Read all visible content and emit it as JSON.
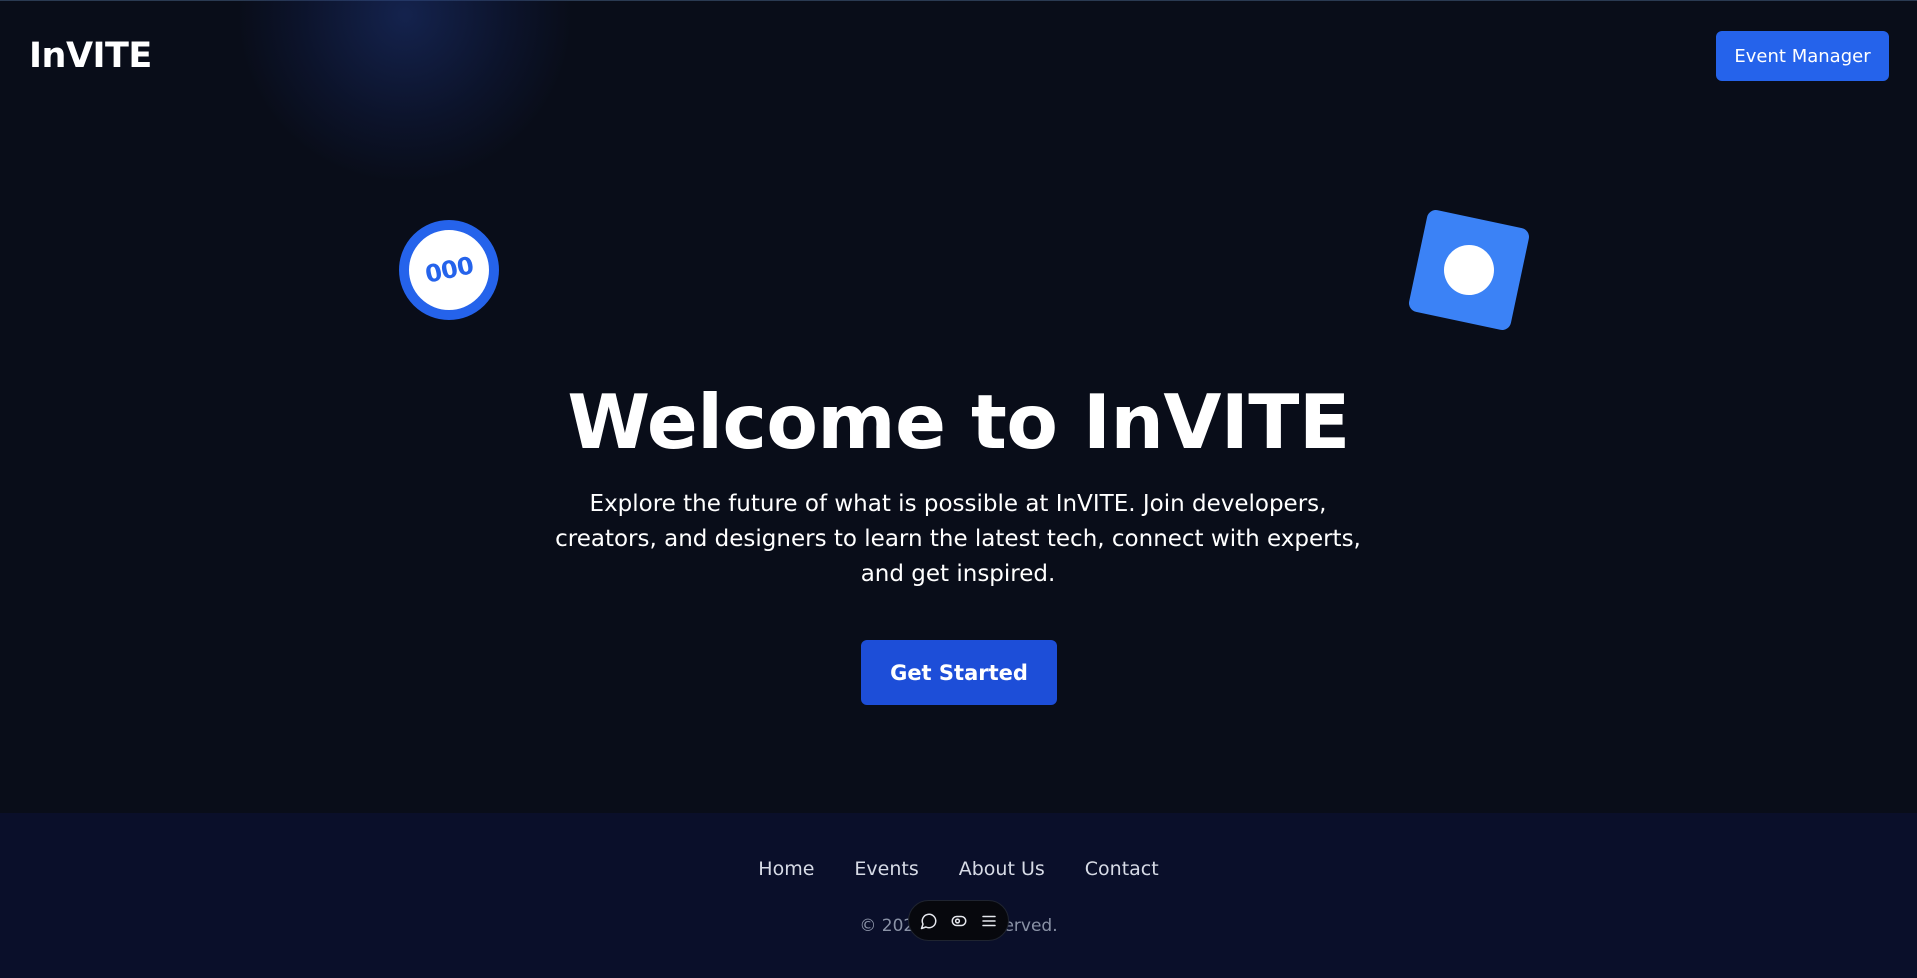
{
  "header": {
    "logo": "InVITE",
    "event_manager_label": "Event Manager"
  },
  "decorations": {
    "badge_text": "000"
  },
  "hero": {
    "title": "Welcome to InVITE",
    "description": "Explore the future of what is possible at InVITE. Join developers, creators, and designers to learn the latest tech, connect with experts, and get inspired.",
    "cta_label": "Get Started"
  },
  "footer": {
    "nav": [
      "Home",
      "Events",
      "About Us",
      "Contact"
    ],
    "copyright": "© 2024 InV                 s reserved."
  },
  "toolbar": {
    "icons": [
      "comment-icon",
      "eye-icon",
      "menu-icon"
    ]
  },
  "colors": {
    "background": "#090d19",
    "accent": "#2563eb",
    "footer_bg": "#0a0f2a"
  }
}
